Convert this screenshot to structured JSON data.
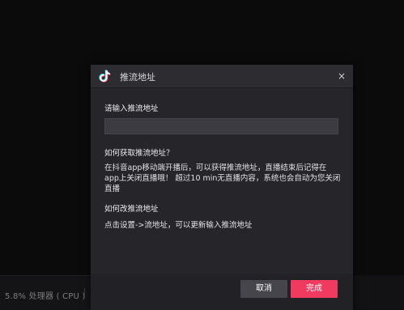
{
  "status_bar": {
    "cpu_text": "5.8% 处理器 ( CPU )"
  },
  "dialog": {
    "title": "推流地址",
    "close_glyph": "×",
    "logo_icon": "douyin-logo",
    "field_label": "请输入推流地址",
    "input": {
      "value": "",
      "placeholder": ""
    },
    "faq": [
      {
        "question": "如何获取推流地址？",
        "answer": "在抖音app移动端开播后，可以获得推流地址，直播结束后记得在app上关闭直播哦！ 超过10 min无直播内容，系统也会自动为您关闭直播"
      },
      {
        "question": "如何改推流地址",
        "answer": "点击设置->流地址，可以更新输入推流地址"
      }
    ],
    "buttons": {
      "cancel": "取消",
      "confirm": "完成"
    }
  },
  "colors": {
    "accent": "#f03a5f",
    "dialog_bg": "#25252a",
    "input_bg": "#3b3b41",
    "page_bg": "#0b0b0c"
  }
}
